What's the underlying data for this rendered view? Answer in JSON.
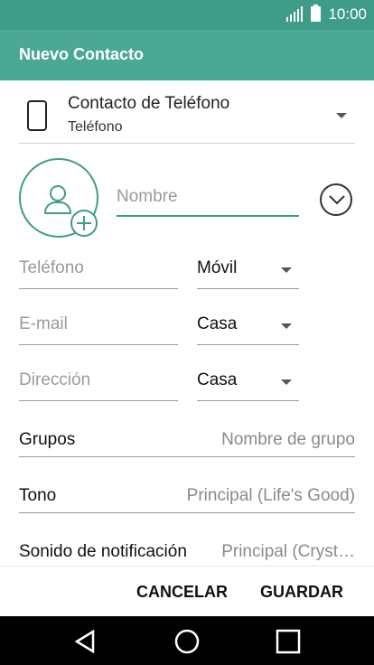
{
  "status_bar": {
    "time": "10:00"
  },
  "app_bar": {
    "title": "Nuevo Contacto"
  },
  "account": {
    "name": "Contacto de Teléfono",
    "type": "Teléfono"
  },
  "name_field": {
    "placeholder": "Nombre",
    "value": ""
  },
  "fields": [
    {
      "placeholder": "Teléfono",
      "value": "",
      "type": "Móvil"
    },
    {
      "placeholder": "E-mail",
      "value": "",
      "type": "Casa"
    },
    {
      "placeholder": "Dirección",
      "value": "",
      "type": "Casa"
    }
  ],
  "groups": {
    "label": "Grupos",
    "value": "Nombre de grupo"
  },
  "ringtone": {
    "label": "Tono",
    "value": "Principal (Life's Good)"
  },
  "notification": {
    "label": "Sonido de notificación",
    "value": "Principal (Cryst…"
  },
  "actions": {
    "cancel": "CANCELAR",
    "save": "GUARDAR"
  },
  "colors": {
    "accent": "#4aa893",
    "status_bar": "#3f9c88"
  }
}
